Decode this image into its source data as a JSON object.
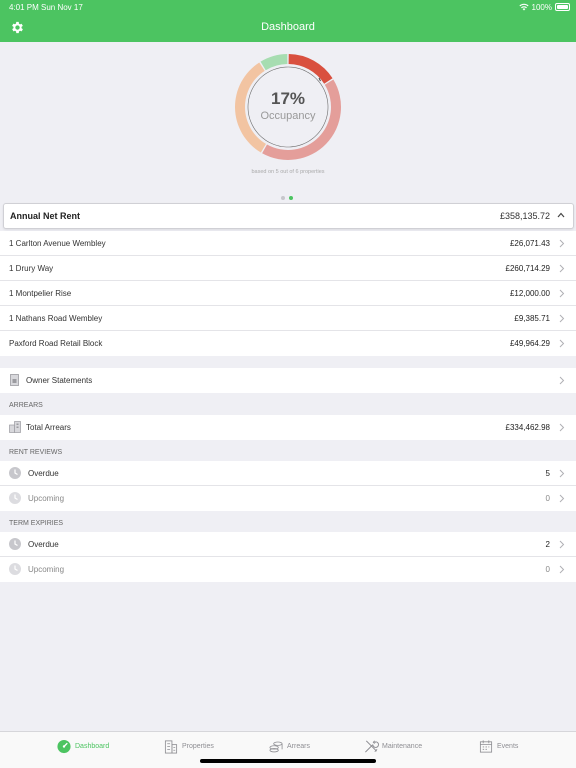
{
  "status_bar": {
    "time": "4:01 PM",
    "date": "Sun Nov 17",
    "battery": "100%"
  },
  "nav": {
    "title": "Dashboard",
    "settings_icon": "gear-icon"
  },
  "occupancy": {
    "percent_label": "17%",
    "label": "Occupancy",
    "footnote": "based on 5 out of 6 properties",
    "segment_colors": [
      "#d9503f",
      "#e49e9a",
      "#f2c4a2",
      "#a7ddb1"
    ],
    "page_count": 2,
    "active_page": 2
  },
  "net_rent": {
    "label": "Annual Net Rent",
    "total": "£358,135.72",
    "rows": [
      {
        "name": "1 Carlton Avenue Wembley",
        "amount": "£26,071.43"
      },
      {
        "name": "1 Drury Way",
        "amount": "£260,714.29"
      },
      {
        "name": "1 Montpelier Rise",
        "amount": "£12,000.00"
      },
      {
        "name": "1 Nathans Road Wembley",
        "amount": "£9,385.71"
      },
      {
        "name": "Paxford Road Retail Block",
        "amount": "£49,964.29"
      }
    ]
  },
  "owner_statements": {
    "label": "Owner Statements"
  },
  "arrears": {
    "section": "ARREARS",
    "label": "Total Arrears",
    "amount": "£334,462.98"
  },
  "rent_reviews": {
    "section": "RENT REVIEWS",
    "overdue_label": "Overdue",
    "overdue_count": "5",
    "upcoming_label": "Upcoming",
    "upcoming_count": "0"
  },
  "term_expiries": {
    "section": "TERM EXPIRIES",
    "overdue_label": "Overdue",
    "overdue_count": "2",
    "upcoming_label": "Upcoming",
    "upcoming_count": "0"
  },
  "tabs": [
    {
      "label": "Dashboard",
      "icon": "dashboard-icon",
      "active": true
    },
    {
      "label": "Properties",
      "icon": "building-icon",
      "active": false
    },
    {
      "label": "Arrears",
      "icon": "coins-icon",
      "active": false
    },
    {
      "label": "Maintenance",
      "icon": "tools-icon",
      "active": false
    },
    {
      "label": "Events",
      "icon": "calendar-icon",
      "active": false
    }
  ],
  "colors": {
    "brand": "#4cc461",
    "background": "#efeff4"
  }
}
